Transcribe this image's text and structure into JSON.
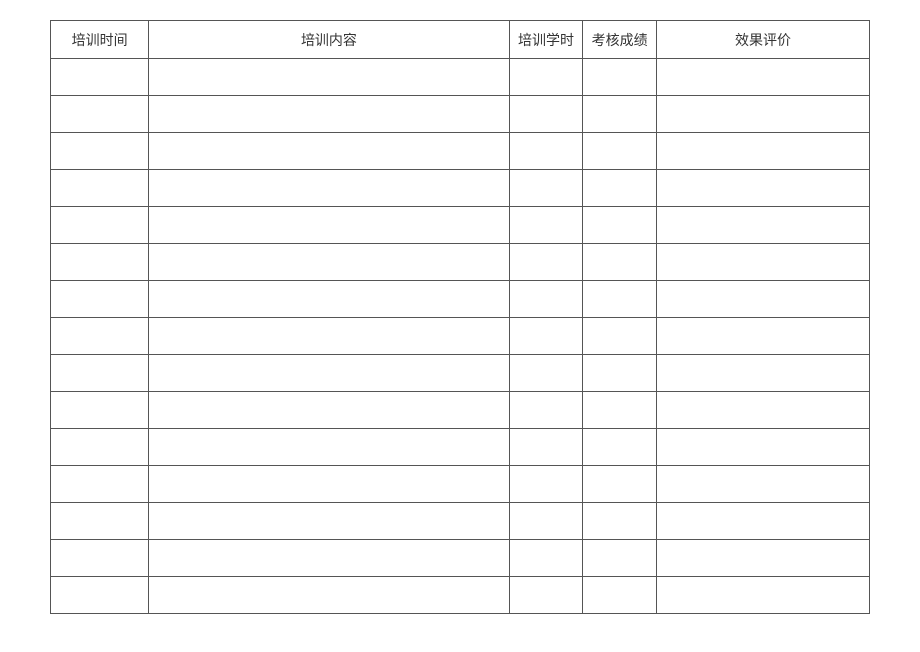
{
  "table": {
    "headers": {
      "time": "培训时间",
      "content": "培训内容",
      "hours": "培训学时",
      "score": "考核成绩",
      "evaluation": "效果评价"
    },
    "rows": [
      {
        "time": "",
        "content": "",
        "hours": "",
        "score": "",
        "evaluation": ""
      },
      {
        "time": "",
        "content": "",
        "hours": "",
        "score": "",
        "evaluation": ""
      },
      {
        "time": "",
        "content": "",
        "hours": "",
        "score": "",
        "evaluation": ""
      },
      {
        "time": "",
        "content": "",
        "hours": "",
        "score": "",
        "evaluation": ""
      },
      {
        "time": "",
        "content": "",
        "hours": "",
        "score": "",
        "evaluation": ""
      },
      {
        "time": "",
        "content": "",
        "hours": "",
        "score": "",
        "evaluation": ""
      },
      {
        "time": "",
        "content": "",
        "hours": "",
        "score": "",
        "evaluation": ""
      },
      {
        "time": "",
        "content": "",
        "hours": "",
        "score": "",
        "evaluation": ""
      },
      {
        "time": "",
        "content": "",
        "hours": "",
        "score": "",
        "evaluation": ""
      },
      {
        "time": "",
        "content": "",
        "hours": "",
        "score": "",
        "evaluation": ""
      },
      {
        "time": "",
        "content": "",
        "hours": "",
        "score": "",
        "evaluation": ""
      },
      {
        "time": "",
        "content": "",
        "hours": "",
        "score": "",
        "evaluation": ""
      },
      {
        "time": "",
        "content": "",
        "hours": "",
        "score": "",
        "evaluation": ""
      },
      {
        "time": "",
        "content": "",
        "hours": "",
        "score": "",
        "evaluation": ""
      },
      {
        "time": "",
        "content": "",
        "hours": "",
        "score": "",
        "evaluation": ""
      }
    ]
  }
}
